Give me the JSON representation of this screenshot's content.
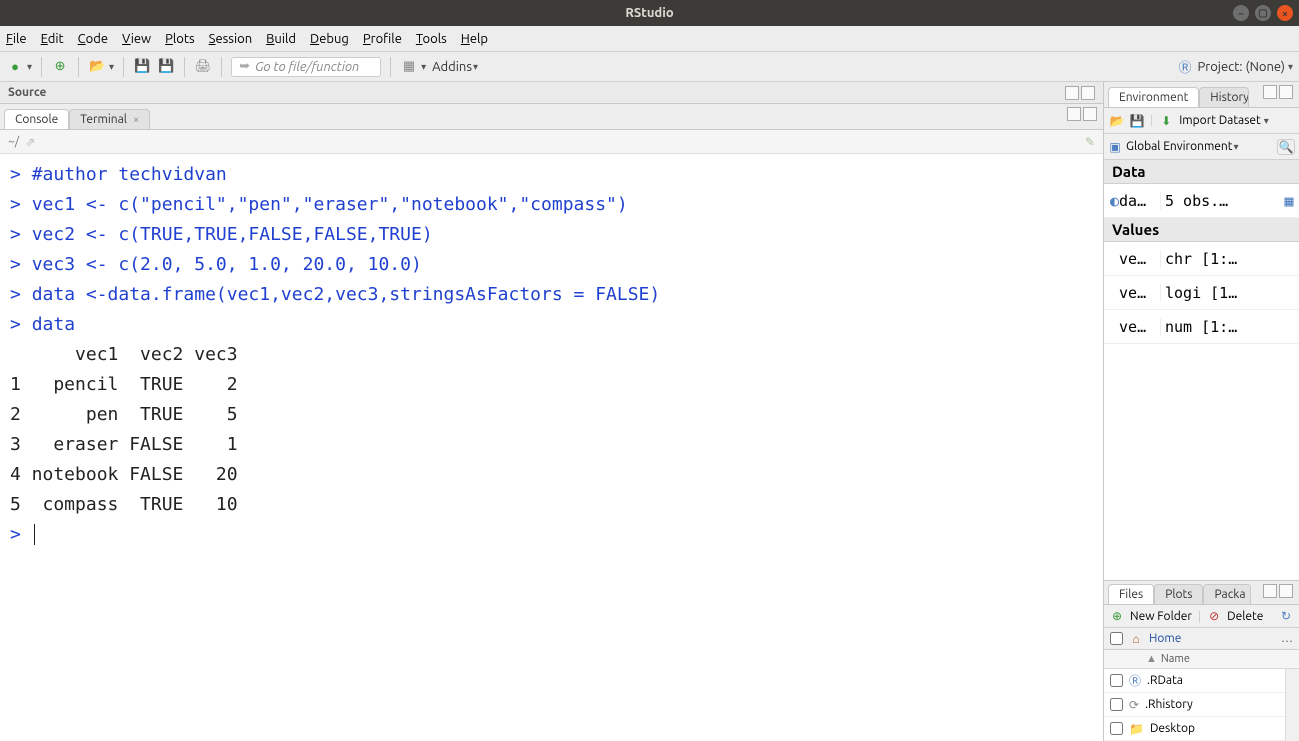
{
  "window": {
    "title": "RStudio"
  },
  "menu": [
    "File",
    "Edit",
    "Code",
    "View",
    "Plots",
    "Session",
    "Build",
    "Debug",
    "Profile",
    "Tools",
    "Help"
  ],
  "toolbar": {
    "goto_placeholder": "Go to file/function",
    "addins_label": "Addins",
    "project_label": "Project: (None)"
  },
  "source": {
    "title": "Source"
  },
  "console": {
    "tab_console": "Console",
    "tab_terminal": "Terminal",
    "path": "~/",
    "lines": [
      {
        "t": "in",
        "text": "#author techvidvan"
      },
      {
        "t": "in",
        "text": "vec1 <- c(\"pencil\",\"pen\",\"eraser\",\"notebook\",\"compass\")"
      },
      {
        "t": "in",
        "text": "vec2 <- c(TRUE,TRUE,FALSE,FALSE,TRUE)"
      },
      {
        "t": "in",
        "text": "vec3 <- c(2.0, 5.0, 1.0, 20.0, 10.0)"
      },
      {
        "t": "in",
        "text": "data <-data.frame(vec1,vec2,vec3,stringsAsFactors = FALSE)"
      },
      {
        "t": "in",
        "text": "data"
      },
      {
        "t": "out",
        "text": "      vec1  vec2 vec3"
      },
      {
        "t": "out",
        "text": "1   pencil  TRUE    2"
      },
      {
        "t": "out",
        "text": "2      pen  TRUE    5"
      },
      {
        "t": "out",
        "text": "3   eraser FALSE    1"
      },
      {
        "t": "out",
        "text": "4 notebook FALSE   20"
      },
      {
        "t": "out",
        "text": "5  compass  TRUE   10"
      },
      {
        "t": "prompt",
        "text": ""
      }
    ]
  },
  "env": {
    "tab_env": "Environment",
    "tab_hist": "History",
    "import_label": "Import Dataset",
    "scope_label": "Global Environment",
    "sections": {
      "data_h": "Data",
      "values_h": "Values"
    },
    "data_rows": [
      {
        "name": "da…",
        "value": "5 obs.…",
        "icon": true
      }
    ],
    "value_rows": [
      {
        "name": "ve…",
        "value": "chr [1:…"
      },
      {
        "name": "ve…",
        "value": "logi [1…"
      },
      {
        "name": "ve…",
        "value": "num [1:…"
      }
    ]
  },
  "files": {
    "tab_files": "Files",
    "tab_plots": "Plots",
    "tab_packages": "Packa",
    "new_folder": "New Folder",
    "delete": "Delete",
    "home": "Home",
    "col_name": "Name",
    "rows": [
      {
        "name": ".RData",
        "icon": "r"
      },
      {
        "name": ".Rhistory",
        "icon": "hist"
      },
      {
        "name": "Desktop",
        "icon": "folder"
      }
    ],
    "more": "…"
  }
}
